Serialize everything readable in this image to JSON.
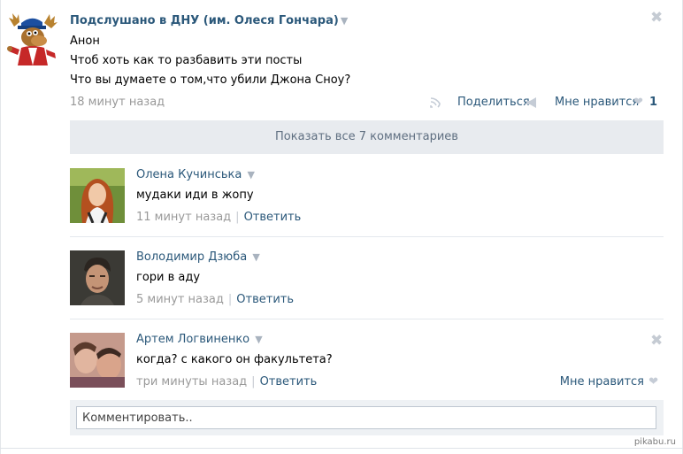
{
  "post": {
    "group_name": "Подслушано в ДНУ (им. Олеся Гончара)",
    "lines": [
      "Анон",
      "Чтоб хоть как то разбавить эти посты",
      "Что вы думаете о том,что убили Джона Сноу?"
    ],
    "time": "18 минут назад",
    "share_label": "Поделиться",
    "like_label": "Мне нравится",
    "like_count": "1"
  },
  "show_all_comments": "Показать все 7 комментариев",
  "comments": [
    {
      "author": "Олена Кучинська",
      "text": "мудаки иди в жопу",
      "time": "11 минут назад",
      "reply_label": "Ответить"
    },
    {
      "author": "Володимир Дзюба",
      "text": "гори в аду",
      "time": "5 минут назад",
      "reply_label": "Ответить"
    },
    {
      "author": "Артем Логвиненко",
      "text": "когда? с какого он факультета?",
      "time": "три минуты назад",
      "reply_label": "Ответить",
      "like_label": "Мне нравится"
    }
  ],
  "reply": {
    "placeholder": "Комментировать.."
  },
  "watermark": "pikabu.ru"
}
